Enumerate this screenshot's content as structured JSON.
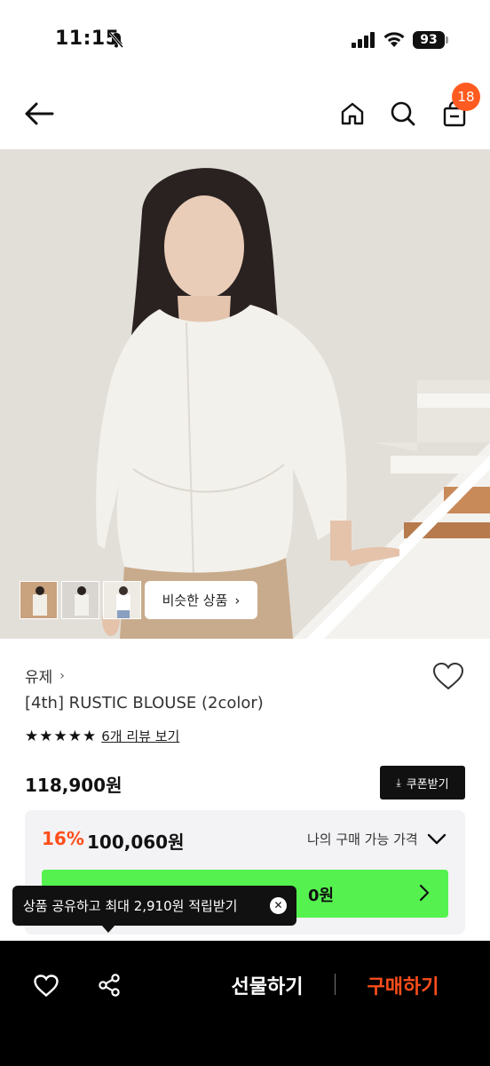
{
  "status_bar": {
    "time": "11:15",
    "battery": "93",
    "icons": [
      "bell-slash-icon",
      "signal-icon",
      "wifi-icon",
      "battery-icon"
    ]
  },
  "header": {
    "icons": [
      "back-arrow-icon",
      "home-icon",
      "search-icon",
      "shopping-bag-icon"
    ],
    "cart_count": "18"
  },
  "gallery": {
    "similar_label": "비슷한 상품",
    "thumbnail_count": 3
  },
  "product": {
    "brand": "유제",
    "title": "[4th] RUSTIC BLOUSE (2color)",
    "rating": 5,
    "review_link": "6개 리뷰 보기",
    "price": "118,900원",
    "coupon_label": "쿠폰받기"
  },
  "price_box": {
    "discount_rate": "16%",
    "discount_price": "100,060원",
    "my_price_label": "나의 구매 가능 가격",
    "green_bar_amount": "0원",
    "colors": {
      "green": "#55f24f",
      "accent": "#ff4e1a"
    }
  },
  "tooltip": {
    "text": "상품 공유하고 최대 2,910원 적립받기"
  },
  "bottom_bar": {
    "gift_label": "선물하기",
    "buy_label": "구매하기",
    "icons": [
      "heart-icon",
      "share-icon"
    ]
  }
}
